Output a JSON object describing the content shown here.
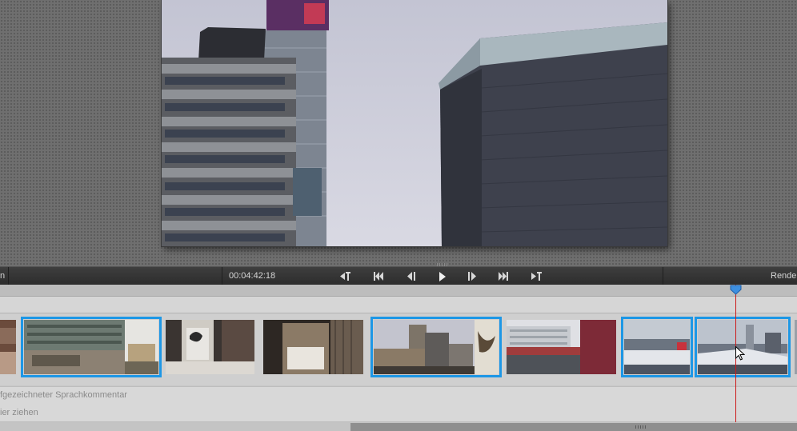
{
  "transport": {
    "left_label": "n",
    "timecode": "00:04:42:18",
    "right_label": "Rende",
    "buttons": [
      {
        "name": "go-to-start-of-movie-icon"
      },
      {
        "name": "go-to-previous-edit-icon"
      },
      {
        "name": "step-back-icon"
      },
      {
        "name": "play-icon"
      },
      {
        "name": "step-forward-icon"
      },
      {
        "name": "go-to-next-edit-icon"
      },
      {
        "name": "go-to-end-of-movie-icon"
      }
    ]
  },
  "tracks": {
    "narration_label": "fgezeichneter Sprachkommentar",
    "dropzone_label": "ier ziehen"
  },
  "clips": [
    {
      "name": "clip-1",
      "selected": false
    },
    {
      "name": "clip-2",
      "selected": true
    },
    {
      "name": "clip-3",
      "selected": false
    },
    {
      "name": "clip-4",
      "selected": false
    },
    {
      "name": "clip-5",
      "selected": true
    },
    {
      "name": "clip-6",
      "selected": false
    },
    {
      "name": "clip-7",
      "selected": true
    },
    {
      "name": "clip-8",
      "selected": true
    }
  ],
  "colors": {
    "selection": "#1d97e6",
    "playhead": "#cc1a1a",
    "playhead_knob": "#3d8fe0"
  }
}
